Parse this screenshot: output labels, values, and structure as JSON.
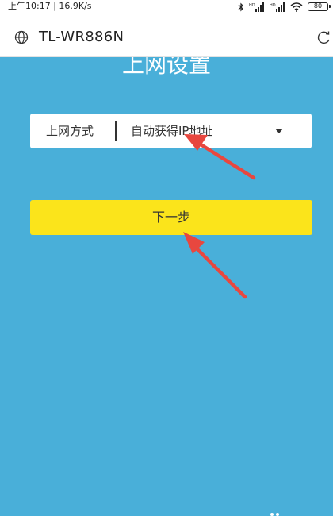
{
  "status_bar": {
    "time": "上午10:17 | 16.9K/s",
    "signal_1_label": "HD",
    "signal_2_label": "HD",
    "battery_level": "80",
    "icons": [
      "bluetooth-icon",
      "signal-icon",
      "signal-icon",
      "wifi-icon",
      "battery-icon"
    ]
  },
  "browser": {
    "site_title": "TL-WR886N",
    "icons": [
      "globe-icon",
      "refresh-icon"
    ]
  },
  "page": {
    "heading": "上网设置",
    "connection_type": {
      "label": "上网方式",
      "value": "自动获得IP地址"
    },
    "next_button_label": "下一步"
  },
  "colors": {
    "background": "#49afd9",
    "button": "#fbe41b",
    "annotation_arrow": "#e8473f"
  }
}
